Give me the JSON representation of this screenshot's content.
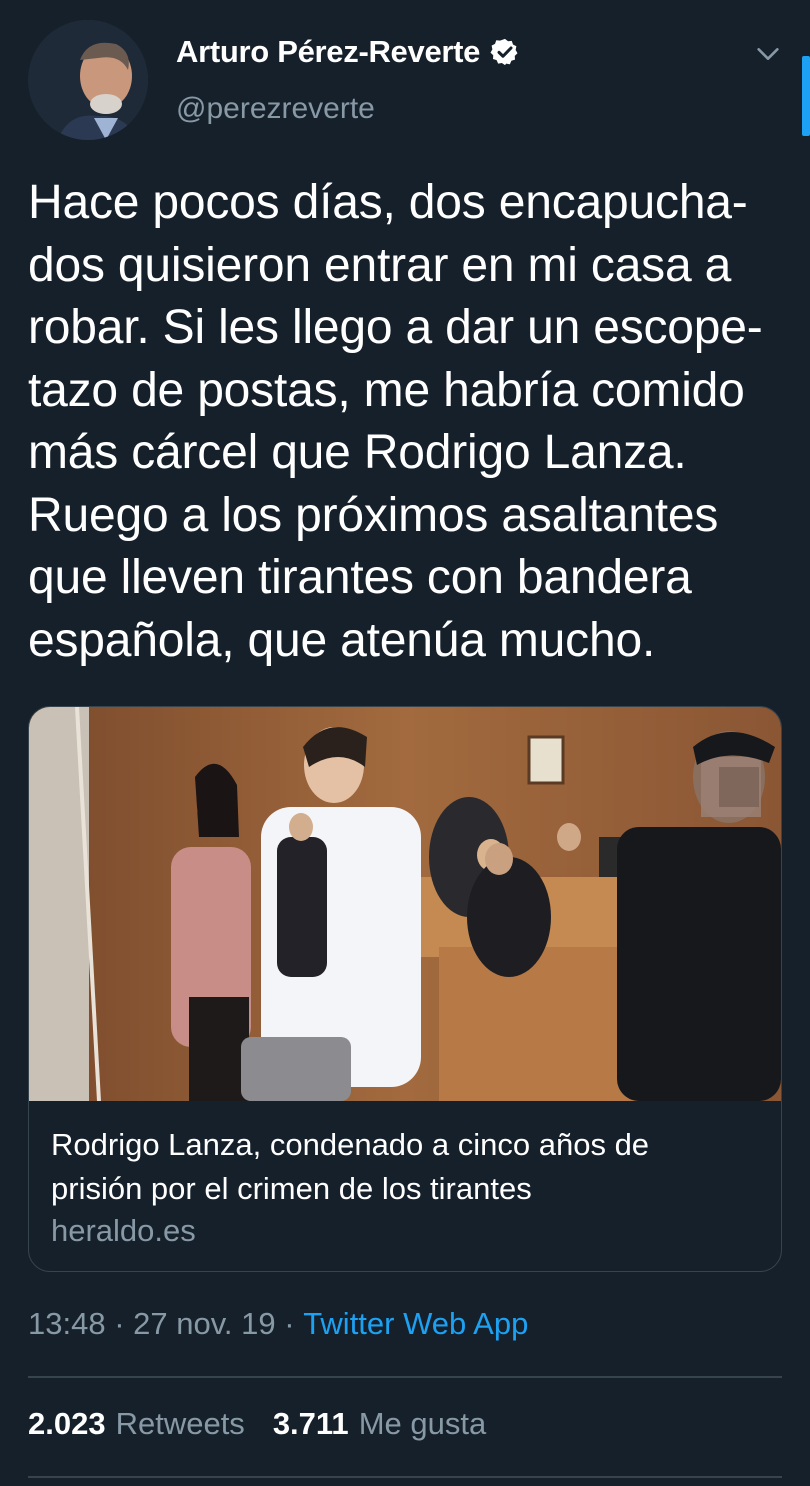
{
  "colors": {
    "background": "#15202b",
    "primary_text": "#ffffff",
    "secondary_text": "#8899a6",
    "accent": "#1da1f2",
    "border": "#38444d"
  },
  "header": {
    "display_name": "Arturo Pérez-Reverte",
    "verified_icon": "verified-badge-icon",
    "handle": "@perezreverte",
    "menu_icon": "chevron-down-icon",
    "avatar_icon": "avatar"
  },
  "tweet": {
    "text": "Hace pocos días, dos encapucha-\ndos quisieron entrar en  mi casa a\nrobar. Si les llego a dar un escope-\ntazo de postas, me habría comido\nmás cárcel que Rodrigo Lanza.\nRuego a los próximos asaltantes\nque lleven tirantes con bandera\nespañola, que atenúa mucho."
  },
  "card": {
    "title": "Rodrigo Lanza, condenado a cinco años de\nprisión por el crimen de los tirantes",
    "domain": "heraldo.es"
  },
  "meta": {
    "time": "13:48",
    "separator": " · ",
    "date": "27 nov. 19",
    "source": "Twitter Web App"
  },
  "stats": {
    "retweets_count": "2.023",
    "retweets_label": "Retweets",
    "likes_count": "3.711",
    "likes_label": "Me gusta"
  }
}
